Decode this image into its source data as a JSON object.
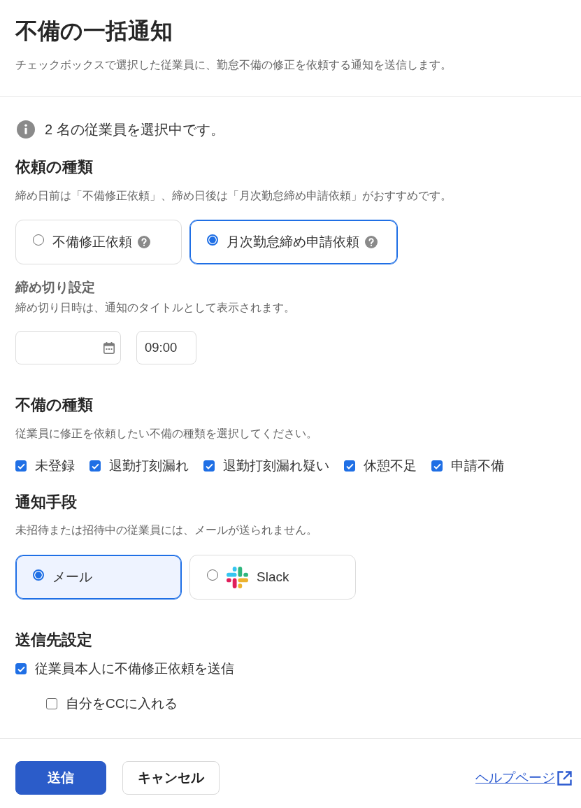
{
  "header": {
    "title": "不備の一括通知",
    "description": "チェックボックスで選択した従業員に、勤怠不備の修正を依頼する通知を送信します。"
  },
  "selection_notice": "2 名の従業員を選択中です。",
  "request_type": {
    "heading": "依頼の種類",
    "hint": "締め日前は「不備修正依頼」、締め日後は「月次勤怠締め申請依頼」がおすすめです。",
    "options": [
      {
        "label": "不備修正依頼",
        "selected": false
      },
      {
        "label": "月次勤怠締め申請依頼",
        "selected": true
      }
    ]
  },
  "deadline": {
    "heading": "締め切り設定",
    "hint": "締め切り日時は、通知のタイトルとして表示されます。",
    "time": {
      "value": "09:00"
    }
  },
  "deficiency_types": {
    "heading": "不備の種類",
    "hint": "従業員に修正を依頼したい不備の種類を選択してください。",
    "items": [
      {
        "label": "未登録",
        "checked": true
      },
      {
        "label": "退勤打刻漏れ",
        "checked": true
      },
      {
        "label": "退勤打刻漏れ疑い",
        "checked": true
      },
      {
        "label": "休憩不足",
        "checked": true
      },
      {
        "label": "申請不備",
        "checked": true
      }
    ]
  },
  "notification_method": {
    "heading": "通知手段",
    "hint": "未招待または招待中の従業員には、メールが送られません。",
    "options": [
      {
        "kind": "mail",
        "label": "メール",
        "selected": true,
        "focused": true
      },
      {
        "kind": "slack",
        "label": "Slack",
        "selected": false,
        "focused": false
      }
    ]
  },
  "recipients": {
    "heading": "送信先設定",
    "items": [
      {
        "label": "従業員本人に不備修正依頼を送信",
        "checked": true,
        "children": [
          {
            "label": "自分をCCに入れる",
            "checked": false
          }
        ]
      }
    ]
  },
  "footer": {
    "buttons": [
      {
        "kind": "primary",
        "label": "送信"
      },
      {
        "kind": "secondary",
        "label": "キャンセル"
      }
    ],
    "help_link": "ヘルプページ"
  }
}
